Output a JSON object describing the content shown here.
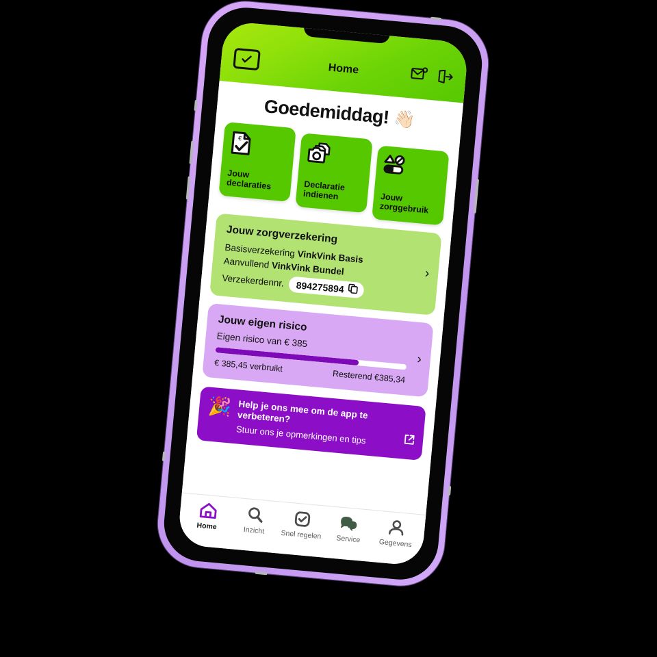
{
  "header": {
    "title": "Home",
    "logo_icon": "checkbox-check-logo",
    "mail_icon": "mail-notification-icon",
    "logout_icon": "logout-icon"
  },
  "greeting": {
    "text": "Goedemiddag!",
    "emoji": "👋🏻"
  },
  "quick_actions": [
    {
      "label": "Jouw declaraties",
      "icon": "document-euro-check-icon"
    },
    {
      "label": "Declaratie indienen",
      "icon": "camera-document-icon"
    },
    {
      "label": "Jouw zorggebruik",
      "icon": "pill-shapes-icon"
    }
  ],
  "insurance_card": {
    "title": "Jouw zorgverzekering",
    "basis_label": "Basisverzekering",
    "basis_value": "VinkVink Basis",
    "aanvullend_label": "Aanvullend",
    "aanvullend_value": "VinkVink Bundel",
    "policy_label": "Verzekerdennr.",
    "policy_number": "894275894",
    "copy_icon": "copy-icon",
    "chevron": "›"
  },
  "deductible_card": {
    "title": "Jouw eigen risico",
    "subtitle": "Eigen risico van € 385",
    "used_text": "€ 385,45 verbruikt",
    "remaining_text": "Resterend €385,34",
    "progress_percent": 75,
    "fill_color": "#7d09b8",
    "chevron": "›"
  },
  "feedback_banner": {
    "emoji": "🎉",
    "title": "Help je ons mee om de app te verbeteren?",
    "subtitle": "Stuur ons je opmerkingen en tips",
    "external_icon": "external-link-icon",
    "background": "#8c0ec6"
  },
  "bottom_nav": [
    {
      "label": "Home",
      "icon": "home-icon",
      "active": true
    },
    {
      "label": "Inzicht",
      "icon": "magnifier-icon",
      "active": false
    },
    {
      "label": "Snel regelen",
      "icon": "checkbox-rounded-icon",
      "active": false
    },
    {
      "label": "Service",
      "icon": "chat-bubbles-icon",
      "active": false
    },
    {
      "label": "Gegevens",
      "icon": "person-icon",
      "active": false
    }
  ]
}
